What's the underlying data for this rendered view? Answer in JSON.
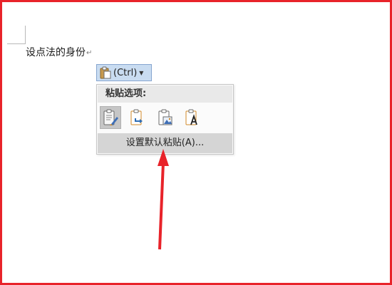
{
  "document": {
    "text": "设点法的身份",
    "paragraph_mark": "↵"
  },
  "paste_options_button": {
    "label": "(Ctrl)",
    "icon": "clipboard-icon",
    "dropdown_icon": "dropdown-arrow-icon"
  },
  "paste_menu": {
    "header": "粘贴选项:",
    "options": [
      {
        "icon": "keep-source-formatting-icon",
        "selected": true
      },
      {
        "icon": "merge-formatting-icon",
        "selected": false
      },
      {
        "icon": "paste-picture-icon",
        "selected": false
      },
      {
        "icon": "keep-text-only-icon",
        "selected": false
      }
    ],
    "set_default_paste": "设置默认粘贴(A)..."
  },
  "annotation": {
    "frame_color": "#e8232a",
    "arrow_color": "#e8232a"
  }
}
